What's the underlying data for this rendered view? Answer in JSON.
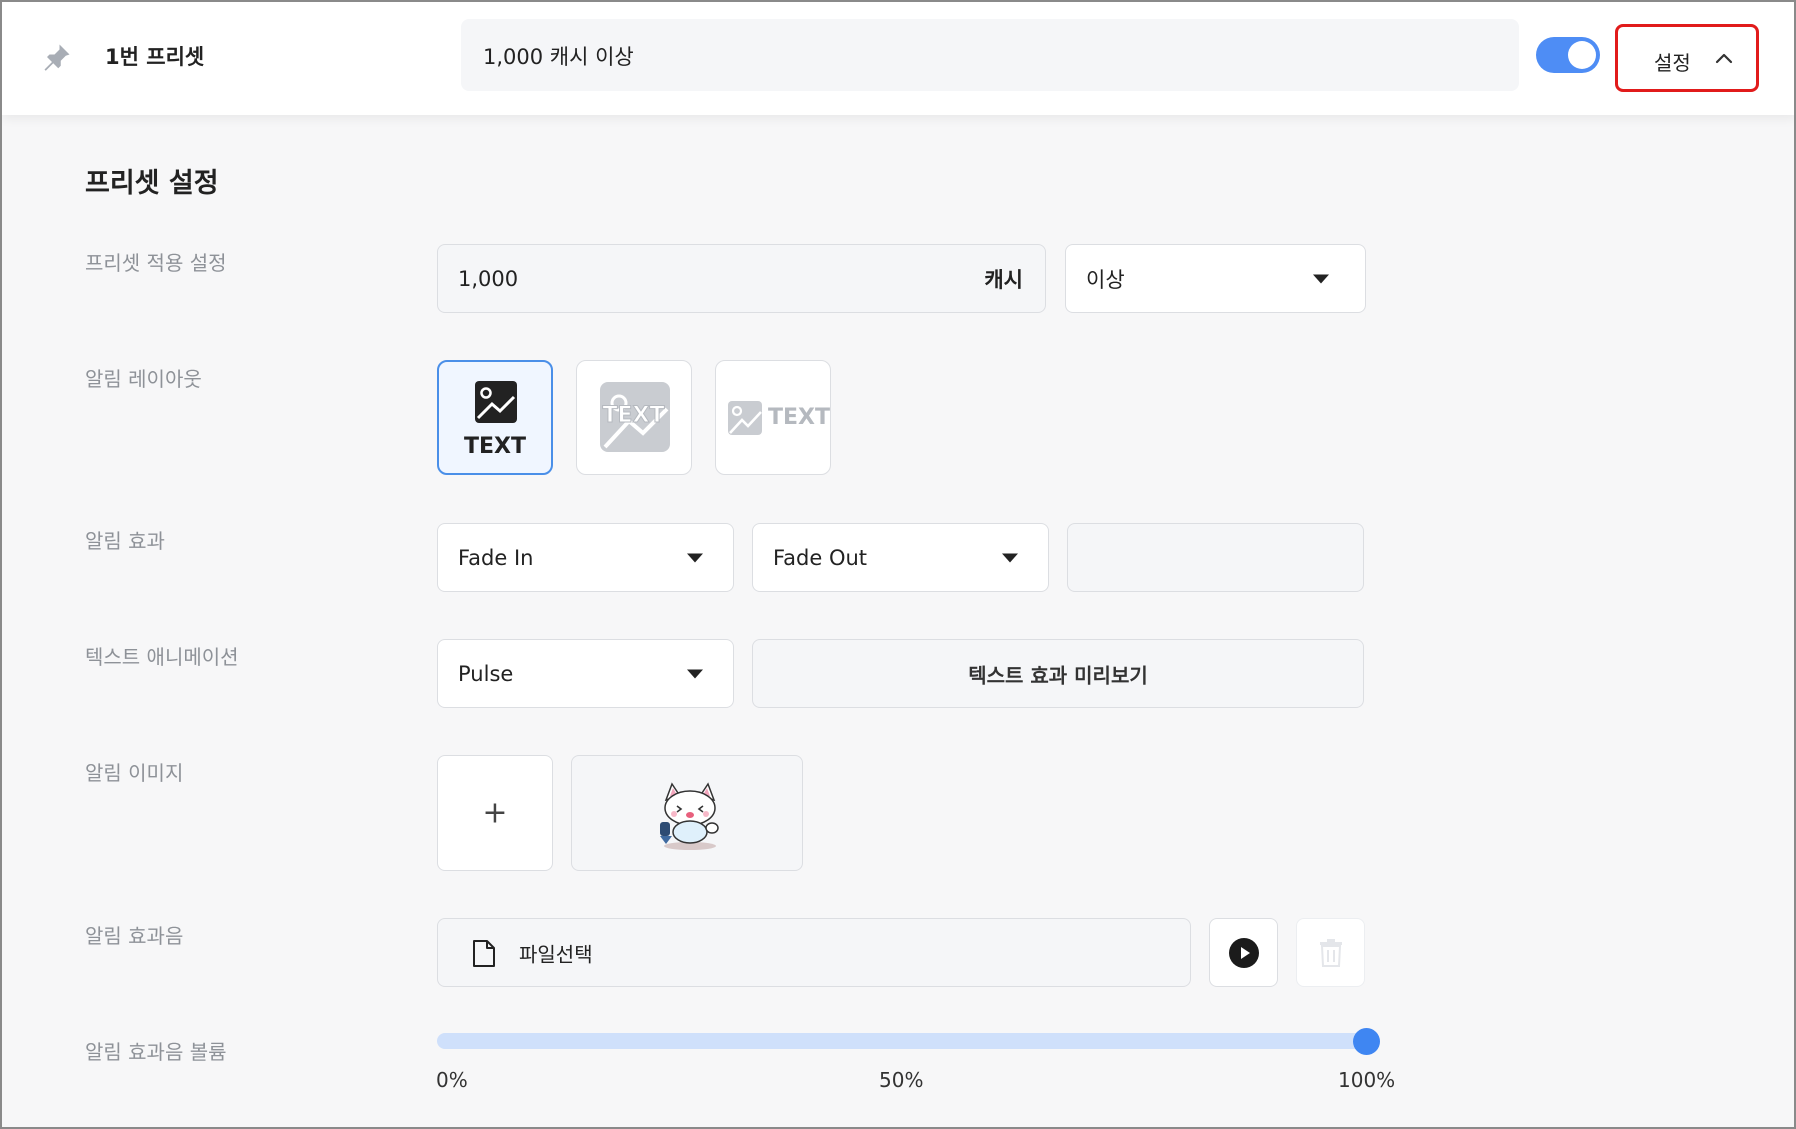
{
  "header": {
    "preset_name": "1번 프리셋",
    "summary": "1,000 캐시 이상",
    "toggle_on": true,
    "settings_label": "설정"
  },
  "section_title": "프리셋 설정",
  "rows": {
    "apply": {
      "label": "프리셋 적용 설정",
      "amount": "1,000",
      "unit": "캐시",
      "condition": "이상"
    },
    "layout": {
      "label": "알림 레이아웃",
      "options": [
        "TEXT",
        "TEXT",
        "TEXT"
      ],
      "selected_index": 0
    },
    "effect": {
      "label": "알림 효과",
      "in": "Fade In",
      "out": "Fade Out",
      "extra": ""
    },
    "text_anim": {
      "label": "텍스트 애니메이션",
      "value": "Pulse",
      "preview_button": "텍스트 효과 미리보기"
    },
    "image": {
      "label": "알림 이미지",
      "add_symbol": "+"
    },
    "sound": {
      "label": "알림 효과음",
      "file_button": "파일선택"
    },
    "volume": {
      "label": "알림 효과음 볼륨",
      "level_percent": 100,
      "ticks": [
        "0%",
        "50%",
        "100%"
      ]
    }
  },
  "colors": {
    "accent": "#4e8df5",
    "highlight_border": "#e11b1b",
    "selected_border": "#4a8fe8"
  }
}
